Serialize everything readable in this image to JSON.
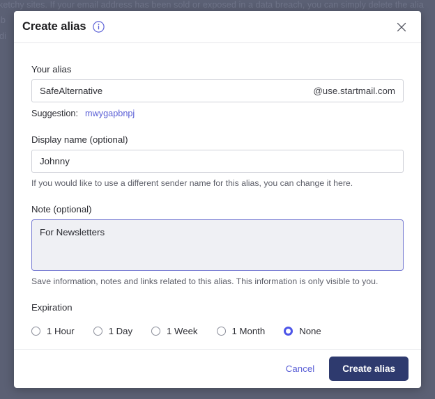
{
  "background": {
    "line1": "ketchy sites. If your email address has been sold or exposed in a data breach, you can simply delete the alia",
    "line2": "nb",
    "line3": "ddi"
  },
  "dialog": {
    "title": "Create alias",
    "info_icon": "info-icon",
    "close_icon": "close-icon",
    "alias": {
      "label": "Your alias",
      "value": "SafeAlternative",
      "placeholder": "",
      "domain_suffix": "@use.startmail.com",
      "suggestion_label": "Suggestion:",
      "suggestion_value": "mwygapbnpj"
    },
    "display_name": {
      "label": "Display name (optional)",
      "value": "Johnny",
      "placeholder": "",
      "help": "If you would like to use a different sender name for this alias, you can change it here."
    },
    "note": {
      "label": "Note (optional)",
      "value": "For Newsletters",
      "placeholder": "",
      "help": "Save information, notes and links related to this alias. This information is only visible to you."
    },
    "expiration": {
      "label": "Expiration",
      "selected": "None",
      "options": [
        {
          "label": "1 Hour",
          "checked": false
        },
        {
          "label": "1 Day",
          "checked": false
        },
        {
          "label": "1 Week",
          "checked": false
        },
        {
          "label": "1 Month",
          "checked": false
        },
        {
          "label": "None",
          "checked": true
        }
      ]
    },
    "footer": {
      "cancel_label": "Cancel",
      "create_label": "Create alias"
    }
  },
  "colors": {
    "accent_link": "#5a5fd6",
    "radio_selected": "#4d55e8",
    "primary_button": "#2e3a6e",
    "backdrop": "#5b6074",
    "focus_border": "#7b7fd4"
  }
}
